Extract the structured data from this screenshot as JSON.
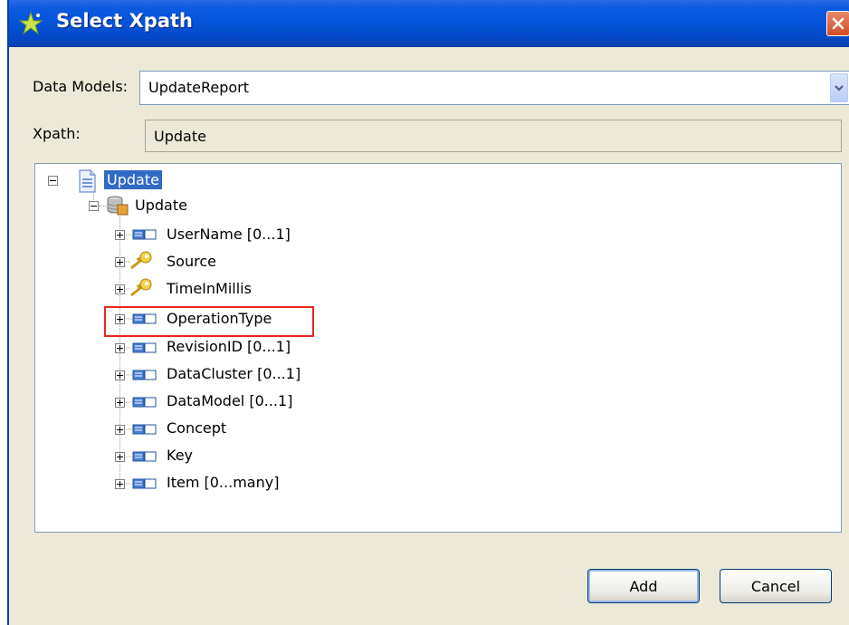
{
  "window": {
    "title": "Select Xpath",
    "close_symbol": "✕"
  },
  "form": {
    "data_models_label": "Data Models:",
    "data_models_value": "UpdateReport",
    "xpath_label": "Xpath:",
    "xpath_value": "Update"
  },
  "tree": {
    "root": {
      "label": "Update",
      "icon": "document-icon",
      "selected": true
    },
    "child": {
      "label": "Update",
      "icon": "entity-icon"
    },
    "items": [
      {
        "label": "UserName  [0...1]",
        "icon": "element-icon"
      },
      {
        "label": "Source",
        "icon": "key-icon"
      },
      {
        "label": "TimeInMillis",
        "icon": "key-icon"
      },
      {
        "label": "OperationType",
        "icon": "element-icon",
        "highlighted": true
      },
      {
        "label": "RevisionID  [0...1]",
        "icon": "element-icon"
      },
      {
        "label": "DataCluster  [0...1]",
        "icon": "element-icon"
      },
      {
        "label": "DataModel  [0...1]",
        "icon": "element-icon"
      },
      {
        "label": "Concept",
        "icon": "element-icon"
      },
      {
        "label": "Key",
        "icon": "element-icon"
      },
      {
        "label": "Item  [0...many]",
        "icon": "element-icon"
      }
    ]
  },
  "buttons": {
    "add": "Add",
    "cancel": "Cancel"
  },
  "colors": {
    "titlebar": "#0553d8",
    "selection": "#316ac5",
    "highlight_box": "#e8261f",
    "window_bg": "#ece9d8"
  }
}
